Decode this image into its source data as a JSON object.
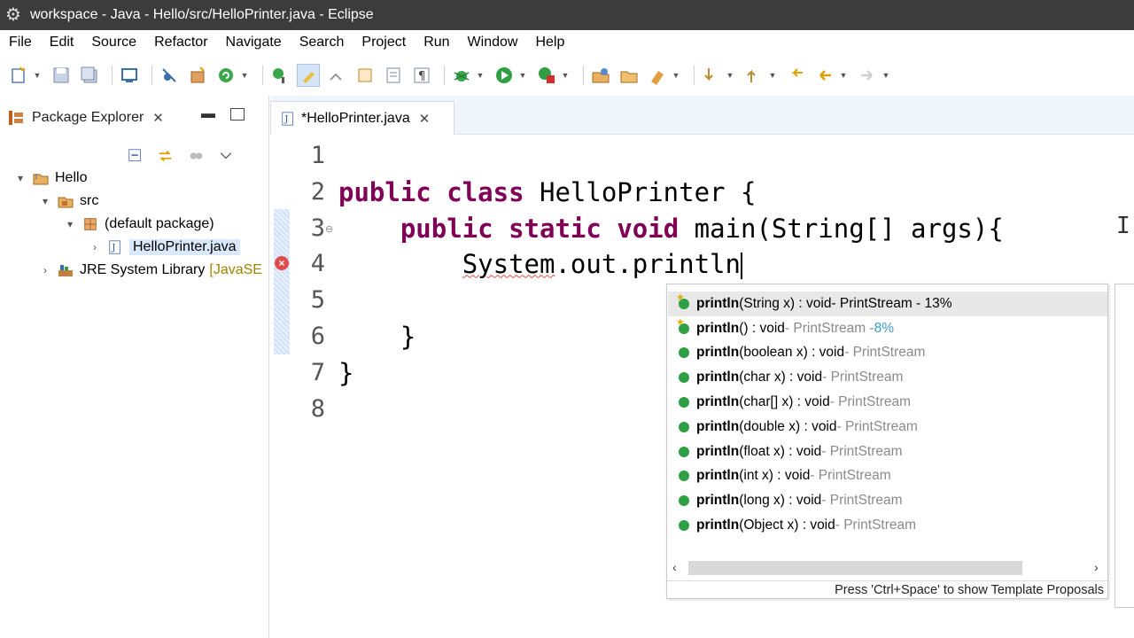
{
  "window": {
    "title": "workspace - Java - Hello/src/HelloPrinter.java - Eclipse"
  },
  "menu": [
    "File",
    "Edit",
    "Source",
    "Refactor",
    "Navigate",
    "Search",
    "Project",
    "Run",
    "Window",
    "Help"
  ],
  "package_explorer": {
    "tab_label": "Package Explorer",
    "tree": [
      {
        "label": "Hello",
        "depth": 0,
        "expanded": true,
        "icon": "project-icon"
      },
      {
        "label": "src",
        "depth": 1,
        "expanded": true,
        "icon": "source-folder-icon"
      },
      {
        "label": "(default package)",
        "depth": 2,
        "expanded": true,
        "icon": "package-icon"
      },
      {
        "label": "HelloPrinter.java",
        "depth": 3,
        "expanded": false,
        "icon": "java-file-icon",
        "selected": true
      },
      {
        "label": "JRE System Library",
        "suffix": "[JavaSE",
        "depth": 0,
        "expanded": false,
        "icon": "library-icon"
      }
    ]
  },
  "editor": {
    "tab_label": "*HelloPrinter.java",
    "line_numbers": [
      "1",
      "2",
      "3",
      "4",
      "5",
      "6",
      "7",
      "8"
    ],
    "code": {
      "l2_kw1": "public",
      "l2_kw2": "class",
      "l2_rest": " HelloPrinter {",
      "l3_kw1": "public",
      "l3_kw2": "static",
      "l3_kw3": "void",
      "l3_rest": " main(String[] args){",
      "l4_system": "System",
      "l4_rest": ".out.println",
      "l6": "}",
      "l7": "}"
    }
  },
  "content_assist": {
    "proposals": [
      {
        "method": "println",
        "params": "(String x) : void",
        "qualifier": " - PrintStream - 13%",
        "star": true,
        "selected": true
      },
      {
        "method": "println",
        "params": "() : void",
        "qualifier": " - PrintStream - ",
        "pct": "8%",
        "star": true
      },
      {
        "method": "println",
        "params": "(boolean x) : void",
        "qualifier": " - PrintStream"
      },
      {
        "method": "println",
        "params": "(char x) : void",
        "qualifier": " - PrintStream"
      },
      {
        "method": "println",
        "params": "(char[] x) : void",
        "qualifier": " - PrintStream"
      },
      {
        "method": "println",
        "params": "(double x) : void",
        "qualifier": " - PrintStream"
      },
      {
        "method": "println",
        "params": "(float x) : void",
        "qualifier": " - PrintStream"
      },
      {
        "method": "println",
        "params": "(int x) : void",
        "qualifier": " - PrintStream"
      },
      {
        "method": "println",
        "params": "(long x) : void",
        "qualifier": " - PrintStream"
      },
      {
        "method": "println",
        "params": "(Object x) : void",
        "qualifier": " - PrintStream"
      }
    ],
    "footer": "Press 'Ctrl+Space' to show Template Proposals"
  },
  "colors": {
    "keyword": "#7f0055",
    "error": "#e14b4b",
    "title_bar": "#3c3c3c",
    "proposal_icon": "#2ea043"
  }
}
